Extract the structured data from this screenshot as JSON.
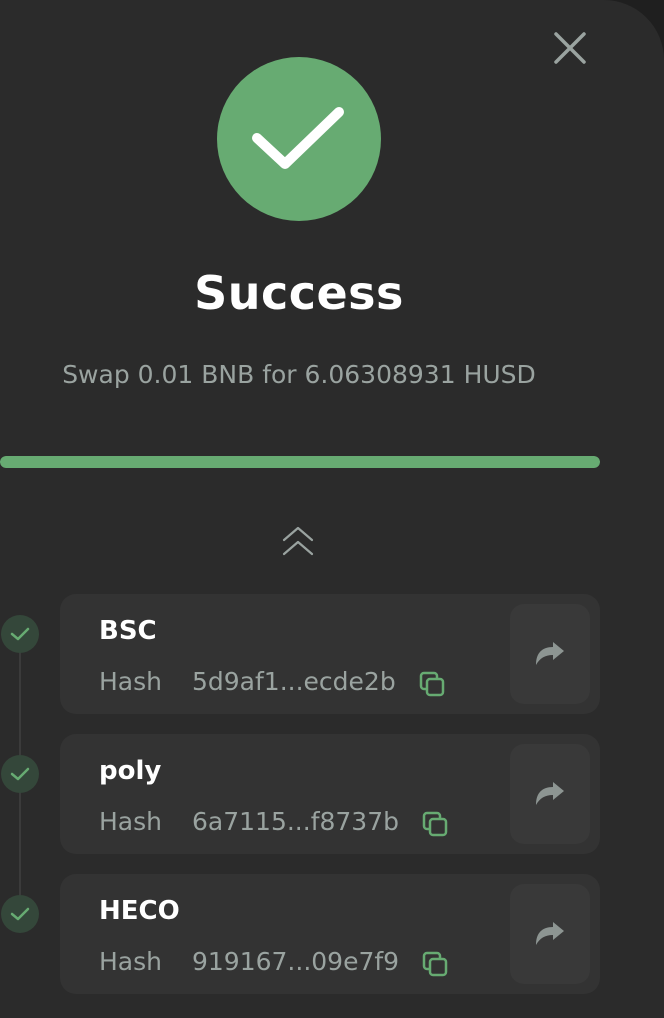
{
  "modal": {
    "title": "Success",
    "subtitle": "Swap 0.01 BNB for 6.06308931 HUSD",
    "progress": 1.0
  },
  "steps": [
    {
      "chain": "BSC",
      "hash_label": "Hash",
      "hash_value": "5d9af1...ecde2b"
    },
    {
      "chain": "poly",
      "hash_label": "Hash",
      "hash_value": "6a7115...f8737b"
    },
    {
      "chain": "HECO",
      "hash_label": "Hash",
      "hash_value": "919167...09e7f9"
    }
  ],
  "colors": {
    "accent": "#67ab72",
    "background": "#2b2b2b",
    "card": "#333333",
    "text_muted": "#9aa3a0"
  },
  "icons": {
    "close": "close-icon",
    "success": "check-icon",
    "collapse": "chevrons-up-icon",
    "copy": "copy-icon",
    "open": "share-arrow-icon"
  }
}
